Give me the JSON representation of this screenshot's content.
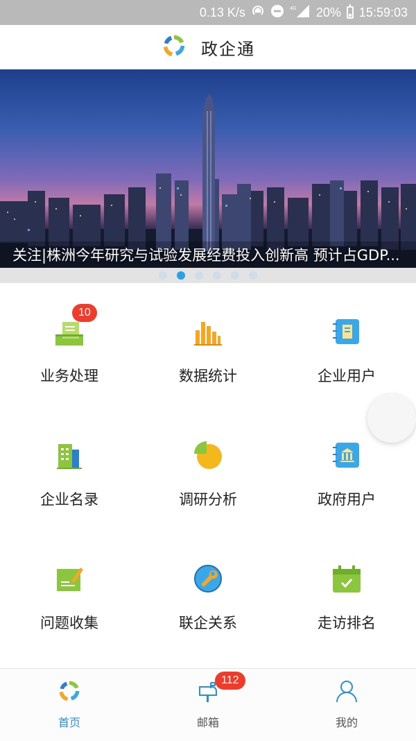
{
  "status_bar": {
    "speed": "0.13 K/s",
    "network": "4G",
    "battery": "20%",
    "time": "15:59:03"
  },
  "header": {
    "title": "政企通",
    "logo_icon": "swirl-logo-icon"
  },
  "banner": {
    "caption": "关注|株洲今年研究与试验发展经费投入创新高 预计占GDP...",
    "slide_count": 6,
    "active_slide": 2
  },
  "menu": [
    {
      "label": "业务处理",
      "icon": "business-processing-icon",
      "badge": "10"
    },
    {
      "label": "数据统计",
      "icon": "bar-chart-icon",
      "badge": ""
    },
    {
      "label": "企业用户",
      "icon": "enterprise-user-book-icon",
      "badge": ""
    },
    {
      "label": "企业名录",
      "icon": "building-directory-icon",
      "badge": ""
    },
    {
      "label": "调研分析",
      "icon": "pie-chart-icon",
      "badge": ""
    },
    {
      "label": "政府用户",
      "icon": "government-book-icon",
      "badge": ""
    },
    {
      "label": "问题收集",
      "icon": "pencil-notepad-icon",
      "badge": ""
    },
    {
      "label": "联企关系",
      "icon": "wrench-globe-icon",
      "badge": ""
    },
    {
      "label": "走访排名",
      "icon": "calendar-check-icon",
      "badge": ""
    }
  ],
  "tabs": [
    {
      "label": "首页",
      "icon": "home-logo-icon",
      "active": true,
      "badge": ""
    },
    {
      "label": "邮箱",
      "icon": "mailbox-icon",
      "active": false,
      "badge": "112"
    },
    {
      "label": "我的",
      "icon": "person-icon",
      "active": false,
      "badge": ""
    }
  ],
  "colors": {
    "accent": "#2a8fd8",
    "badge": "#f03b2b",
    "green": "#8cc63f",
    "orange": "#f5a623",
    "blue": "#3aa8e8"
  }
}
